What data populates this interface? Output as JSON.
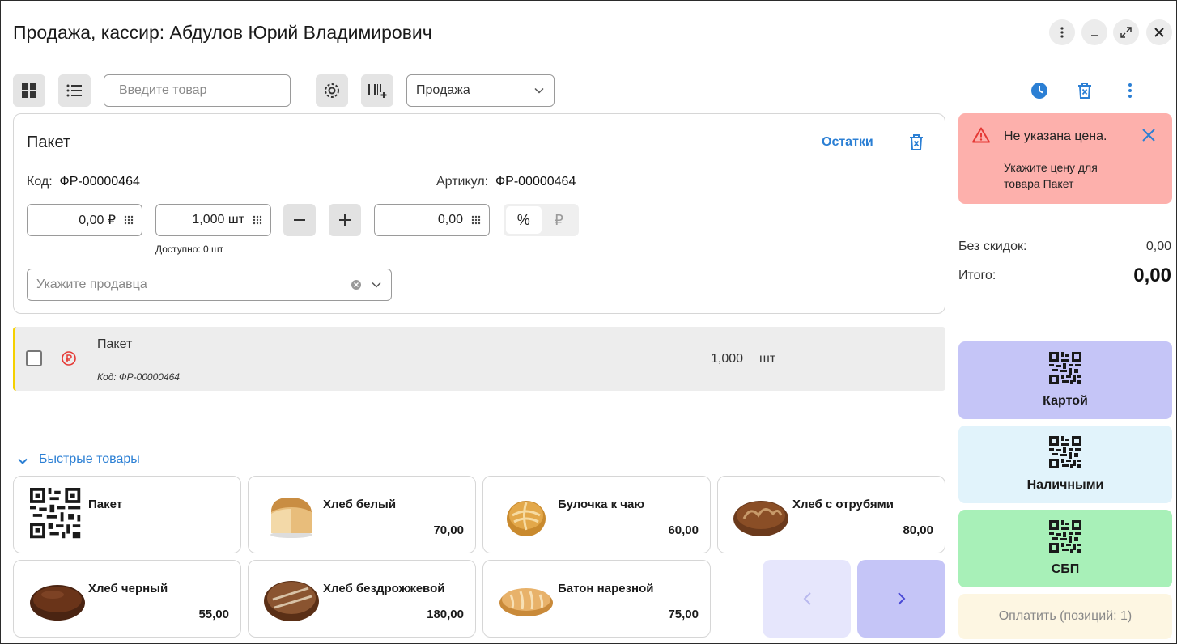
{
  "window": {
    "title": "Продажа, кассир: Абдулов Юрий Владимирович"
  },
  "toolbar": {
    "search_placeholder": "Введите товар",
    "mode_select": "Продажа"
  },
  "product_card": {
    "name": "Пакет",
    "remains_link": "Остатки",
    "code_label": "Код:",
    "code_value": "ФР-00000464",
    "article_label": "Артикул:",
    "article_value": "ФР-00000464",
    "price_value": "0,00 ₽",
    "quantity_value": "1,000 шт",
    "discount_value": "0,00",
    "discount_percent": "%",
    "discount_rub": "₽",
    "available_text": "Доступно: 0 шт",
    "seller_placeholder": "Укажите продавца"
  },
  "cart": {
    "items": [
      {
        "name": "Пакет",
        "code": "Код: ФР-00000464",
        "quantity": "1,000",
        "unit": "шт"
      }
    ]
  },
  "quick_products": {
    "title": "Быстрые товары",
    "items": [
      {
        "name": "Пакет",
        "price": ""
      },
      {
        "name": "Хлеб белый",
        "price": "70,00"
      },
      {
        "name": "Булочка к чаю",
        "price": "60,00"
      },
      {
        "name": "Хлеб с отрубями",
        "price": "80,00"
      },
      {
        "name": "Хлеб черный",
        "price": "55,00"
      },
      {
        "name": "Хлеб бездрожжевой",
        "price": "180,00"
      },
      {
        "name": "Батон нарезной",
        "price": "75,00"
      }
    ]
  },
  "alert": {
    "title": "Не указана цена.",
    "message": "Укажите цену для товара Пакет"
  },
  "totals": {
    "no_discount_label": "Без скидок:",
    "no_discount_value": "0,00",
    "total_label": "Итого:",
    "total_value": "0,00"
  },
  "payment": {
    "card": "Картой",
    "cash": "Наличными",
    "sbp": "СБП",
    "pay": "Оплатить (позиций: 1)"
  },
  "colors": {
    "accent": "#2b7fd4",
    "card_bg": "#c5c5f7",
    "cash_bg": "#e1f3fb",
    "sbp_bg": "#a8f0b8",
    "pay_bg": "#fdf6e2",
    "alert_bg": "#fdb0ac",
    "row_marker": "#f5d000"
  }
}
